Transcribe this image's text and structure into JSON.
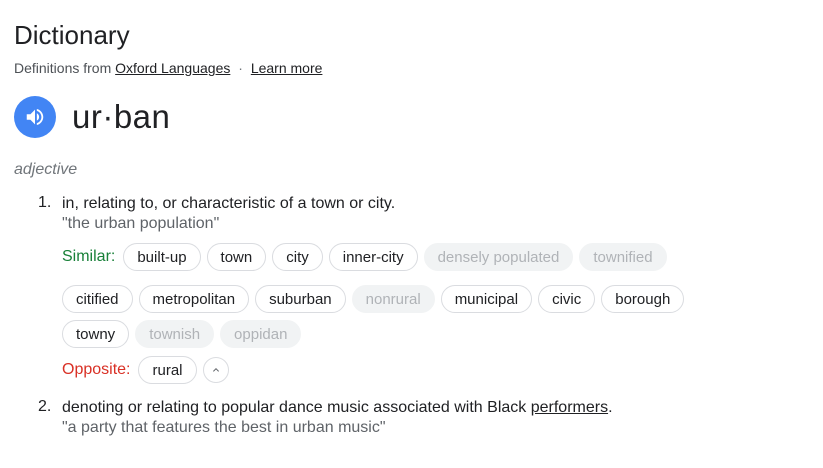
{
  "header": {
    "title": "Dictionary",
    "source_prefix": "Definitions from",
    "source_link": "Oxford Languages",
    "separator": "·",
    "learn_more": "Learn more"
  },
  "entry": {
    "headword": "ur·ban",
    "part_of_speech": "adjective",
    "audio_icon": "speaker-icon"
  },
  "senses": [
    {
      "number": "1.",
      "definition": "in, relating to, or characteristic of a town or city.",
      "example": "\"the urban population\"",
      "similar_label": "Similar:",
      "similar_row1": [
        {
          "text": "built-up",
          "muted": false
        },
        {
          "text": "town",
          "muted": false
        },
        {
          "text": "city",
          "muted": false
        },
        {
          "text": "inner-city",
          "muted": false
        },
        {
          "text": "densely populated",
          "muted": true
        },
        {
          "text": "townified",
          "muted": true
        }
      ],
      "similar_row2": [
        {
          "text": "citified",
          "muted": false
        },
        {
          "text": "metropolitan",
          "muted": false
        },
        {
          "text": "suburban",
          "muted": false
        },
        {
          "text": "nonrural",
          "muted": true
        },
        {
          "text": "municipal",
          "muted": false
        },
        {
          "text": "civic",
          "muted": false
        },
        {
          "text": "borough",
          "muted": false
        }
      ],
      "similar_row3": [
        {
          "text": "towny",
          "muted": false
        },
        {
          "text": "townish",
          "muted": true
        },
        {
          "text": "oppidan",
          "muted": true
        }
      ],
      "opposite_label": "Opposite:",
      "opposite": [
        {
          "text": "rural",
          "muted": false
        }
      ]
    },
    {
      "number": "2.",
      "definition_before": "denoting or relating to popular dance music associated with Black ",
      "definition_link": "performers",
      "definition_after": ".",
      "example": "\"a party that features the best in urban music\""
    }
  ],
  "colors": {
    "audio_button": "#4285f4",
    "similar_label": "#188038",
    "opposite_label": "#d93025"
  }
}
